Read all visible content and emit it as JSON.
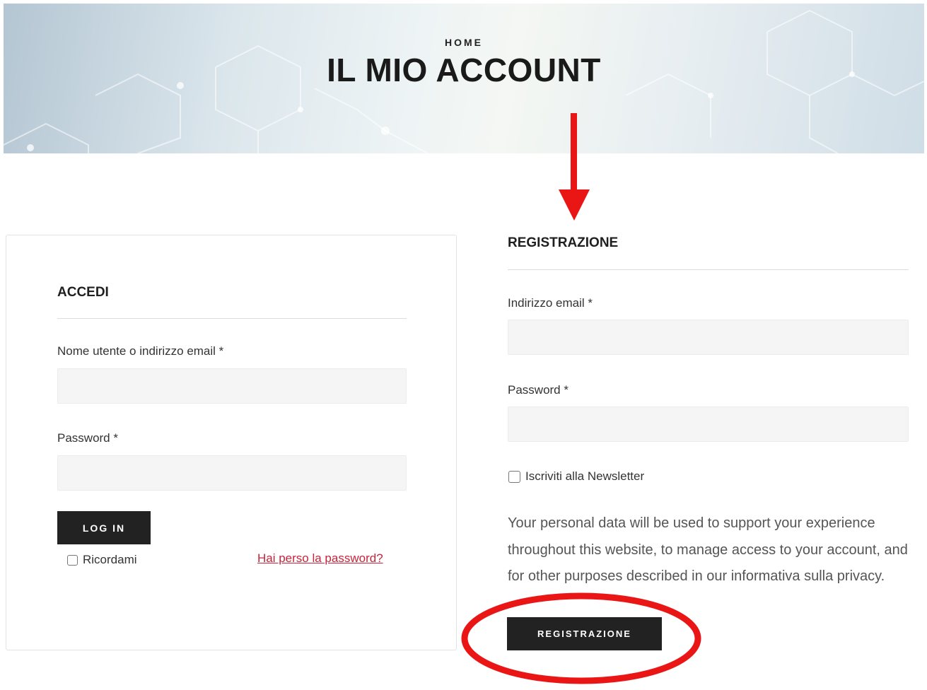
{
  "header": {
    "breadcrumb": "HOME",
    "title": "IL MIO ACCOUNT"
  },
  "login": {
    "title": "ACCEDI",
    "username_label": "Nome utente o indirizzo email *",
    "username_value": "",
    "password_label": "Password *",
    "password_value": "",
    "submit_label": "LOG IN",
    "remember_label": "Ricordami",
    "remember_checked": false,
    "lost_password_label": "Hai perso la password?"
  },
  "register": {
    "title": "REGISTRAZIONE",
    "email_label": "Indirizzo email *",
    "email_value": "",
    "password_label": "Password *",
    "password_value": "",
    "newsletter_label": "Iscriviti alla Newsletter",
    "newsletter_checked": false,
    "privacy_text": "Your personal data will be used to support your experience throughout this website, to manage access to your account, and for other purposes described in our informativa sulla privacy.",
    "submit_label": "REGISTRAZIONE"
  },
  "annotations": {
    "arrow_color": "#ea1616",
    "ellipse_color": "#ea1616",
    "arrow_icon": "arrow-down-icon",
    "ellipse_icon": "highlight-ellipse"
  },
  "colors": {
    "button_bg": "#222222",
    "link": "#c7243a",
    "input_bg": "#f5f5f5"
  }
}
